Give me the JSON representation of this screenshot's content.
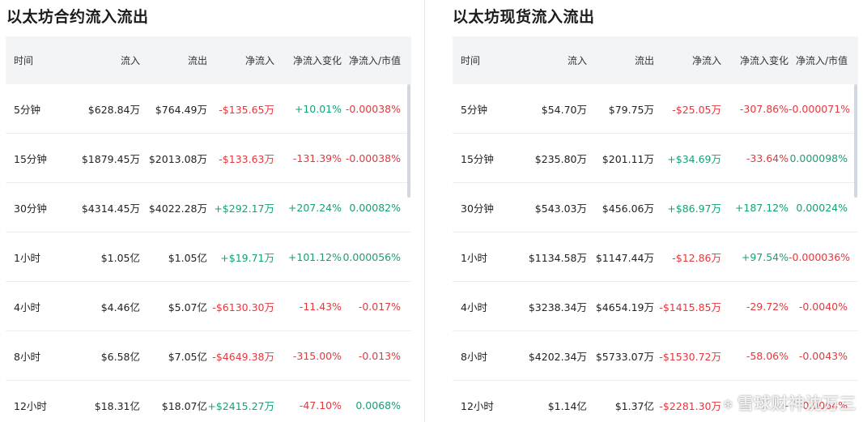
{
  "left": {
    "title": "以太坊合约流入流出",
    "headers": [
      "时间",
      "流入",
      "流出",
      "净流入",
      "净流入变化",
      "净流入/市值"
    ],
    "rows": [
      [
        "5分钟",
        "$628.84万",
        "$764.49万",
        "-$135.65万",
        "+10.01%",
        "-0.00038%"
      ],
      [
        "15分钟",
        "$1879.45万",
        "$2013.08万",
        "-$133.63万",
        "-131.39%",
        "-0.00038%"
      ],
      [
        "30分钟",
        "$4314.45万",
        "$4022.28万",
        "+$292.17万",
        "+207.24%",
        "0.00082%"
      ],
      [
        "1小时",
        "$1.05亿",
        "$1.05亿",
        "+$19.71万",
        "+101.12%",
        "0.000056%"
      ],
      [
        "4小时",
        "$4.46亿",
        "$5.07亿",
        "-$6130.30万",
        "-11.43%",
        "-0.017%"
      ],
      [
        "8小时",
        "$6.58亿",
        "$7.05亿",
        "-$4649.38万",
        "-315.00%",
        "-0.013%"
      ],
      [
        "12小时",
        "$18.31亿",
        "$18.07亿",
        "+$2415.27万",
        "-47.10%",
        "0.0068%"
      ]
    ]
  },
  "right": {
    "title": "以太坊现货流入流出",
    "headers": [
      "时间",
      "流入",
      "流出",
      "净流入",
      "净流入变化",
      "净流入/市值"
    ],
    "rows": [
      [
        "5分钟",
        "$54.70万",
        "$79.75万",
        "-$25.05万",
        "-307.86%",
        "-0.000071%"
      ],
      [
        "15分钟",
        "$235.80万",
        "$201.11万",
        "+$34.69万",
        "-33.64%",
        "0.000098%"
      ],
      [
        "30分钟",
        "$543.03万",
        "$456.06万",
        "+$86.97万",
        "+187.12%",
        "0.00024%"
      ],
      [
        "1小时",
        "$1134.58万",
        "$1147.44万",
        "-$12.86万",
        "+97.54%",
        "-0.000036%"
      ],
      [
        "4小时",
        "$3238.34万",
        "$4654.19万",
        "-$1415.85万",
        "-29.72%",
        "-0.0040%"
      ],
      [
        "8小时",
        "$4202.34万",
        "$5733.07万",
        "-$1530.72万",
        "-58.06%",
        "-0.0043%"
      ],
      [
        "12小时",
        "$1.14亿",
        "$1.37亿",
        "-$2281.30万",
        "-",
        "-0.0064%"
      ]
    ]
  },
  "watermark": "雪球财神沈万三",
  "colors": {
    "up": "#16a07a",
    "down": "#e0393e",
    "header_bg": "#f3f4f6"
  }
}
